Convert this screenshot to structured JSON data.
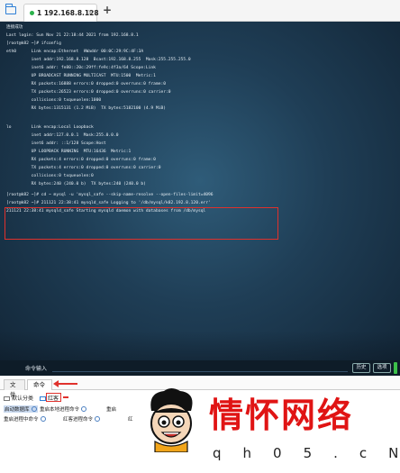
{
  "tabbar": {
    "tab_label": "1 192.168.8.128",
    "close_symbol": "×",
    "add_symbol": "+"
  },
  "terminal": {
    "lines": [
      "连接成功",
      "Last login: Sun Nov 21 22:18:44 2021 from 192.168.8.1",
      "[root@k82 ~]# ifconfig",
      "eth0      Link encap:Ethernet  HWaddr 00:0C:29:9C:4F:3A",
      "          inet addr:192.168.8.128  Bcast:192.168.8.255  Mask:255.255.255.0",
      "          inet6 addr: fe80::20c:29ff:fe9c:4f3a/64 Scope:Link",
      "          UP BROADCAST RUNNING MULTICAST  MTU:1500  Metric:1",
      "          RX packets:16888 errors:0 dropped:0 overruns:0 frame:0",
      "          TX packets:26523 errors:0 dropped:0 overruns:0 carrier:0",
      "          collisions:0 txqueuelen:1000",
      "          RX bytes:1315131 (1.2 MiB)  TX bytes:5182100 (4.9 MiB)",
      "",
      "lo        Link encap:Local Loopback",
      "          inet addr:127.0.0.1  Mask:255.0.0.0",
      "          inet6 addr: ::1/128 Scope:Host",
      "          UP LOOPBACK RUNNING  MTU:16436  Metric:1",
      "          RX packets:4 errors:0 dropped:0 overruns:0 frame:0",
      "          TX packets:4 errors:0 dropped:0 overruns:0 carrier:0",
      "          collisions:0 txqueuelen:0",
      "          RX bytes:240 (240.0 b)  TX bytes:240 (240.0 b)",
      "",
      "[root@k82 ~]# cd ~ mysql -u 'mysql_safe --skip-name-resolve --open-files-limit=4096",
      "[root@k82 ~]# 211121 22:38:41 mysqld_safe Logging to '/db/mysql/k82.192.8.120.err'",
      "211121 22:38:41 mysqld_safe Starting mysqld daemon with databases from /db/mysql"
    ]
  },
  "input_bar": {
    "label": "命令输入",
    "history_button": "历史",
    "options_button": "选项"
  },
  "bottom_tabs": {
    "file": "文件",
    "command": "命令"
  },
  "categories": {
    "default": "默认分类",
    "selected": "红客"
  },
  "commands": {
    "row1": [
      "启动数据库",
      "重启本地进程命令",
      "重启"
    ],
    "row2": [
      "重启进程中命令",
      "红客进程命令",
      "红"
    ]
  },
  "watermark": {
    "title": "情怀网络",
    "subtitle": "qh05.cN"
  },
  "colors": {
    "accent": "#2e7fd6",
    "highlight_red": "#e0312c",
    "terminal_text": "#e6eef4",
    "watermark_red": "#e01414"
  }
}
